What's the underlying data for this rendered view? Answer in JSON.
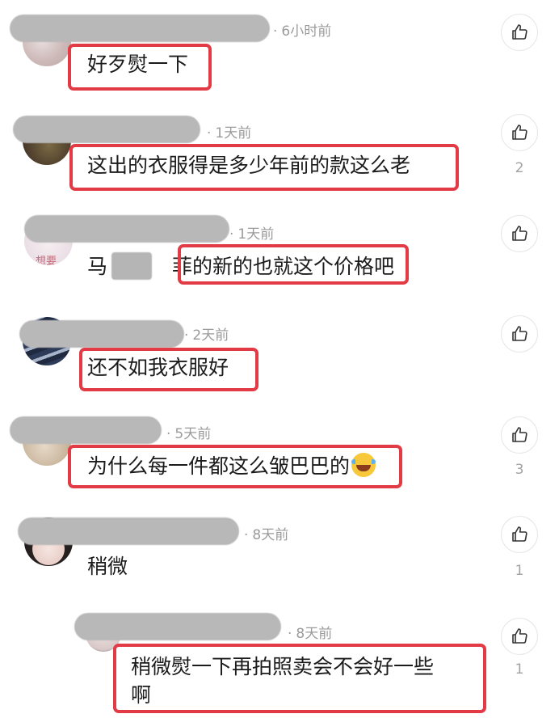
{
  "colors": {
    "highlight": "#e23b45",
    "time": "#9b9b9b",
    "text": "#1b1b1b"
  },
  "comments": [
    {
      "time": "6小时前",
      "text": "好歹熨一下",
      "likes": "",
      "avatar_text": ""
    },
    {
      "time": "1天前",
      "text": "这出的衣服得是多少年前的款这么老",
      "likes": "2",
      "avatar_text": ""
    },
    {
      "time": "1天前",
      "text_prefix": "马",
      "text_mid": "菲",
      "text_suffix": "的新的也就这个价格吧",
      "likes": "",
      "avatar_text": "想要"
    },
    {
      "time": "2天前",
      "text": "还不如我衣服好",
      "likes": "",
      "avatar_text": ""
    },
    {
      "time": "5天前",
      "text": "为什么每一件都这么皱巴巴的",
      "emoji": "face-with-tears-of-joy-icon",
      "likes": "3",
      "avatar_text": ""
    },
    {
      "time": "8天前",
      "text": "稍微",
      "likes": "1",
      "avatar_text": ""
    },
    {
      "time": "8天前",
      "text_line1": "稍微熨一下再拍照卖会不会好一些",
      "text_line2": "啊",
      "likes": "1",
      "avatar_text": ""
    }
  ],
  "icons": {
    "like": "thumbs-up-icon",
    "separator": "·"
  }
}
